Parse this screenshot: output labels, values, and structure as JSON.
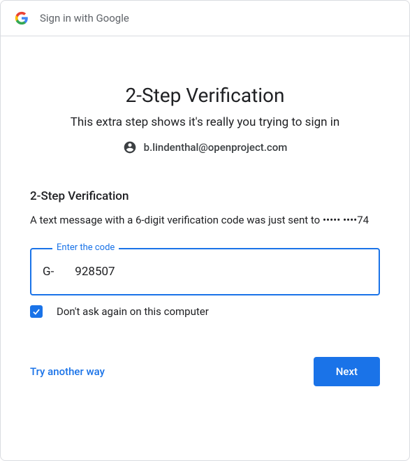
{
  "header": {
    "title": "Sign in with Google"
  },
  "page": {
    "title": "2-Step Verification",
    "subtitle": "This extra step shows it's really you trying to sign in",
    "account_email": "b.lindenthal@openproject.com"
  },
  "verification": {
    "section_title": "2-Step Verification",
    "description": "A text message with a 6-digit verification code was just sent to ••••• ••••74",
    "code_label": "Enter the code",
    "code_prefix": "G-",
    "code_value": "928507",
    "dont_ask_label": "Don't ask again on this computer",
    "dont_ask_checked": true
  },
  "actions": {
    "try_another": "Try another way",
    "next": "Next"
  }
}
